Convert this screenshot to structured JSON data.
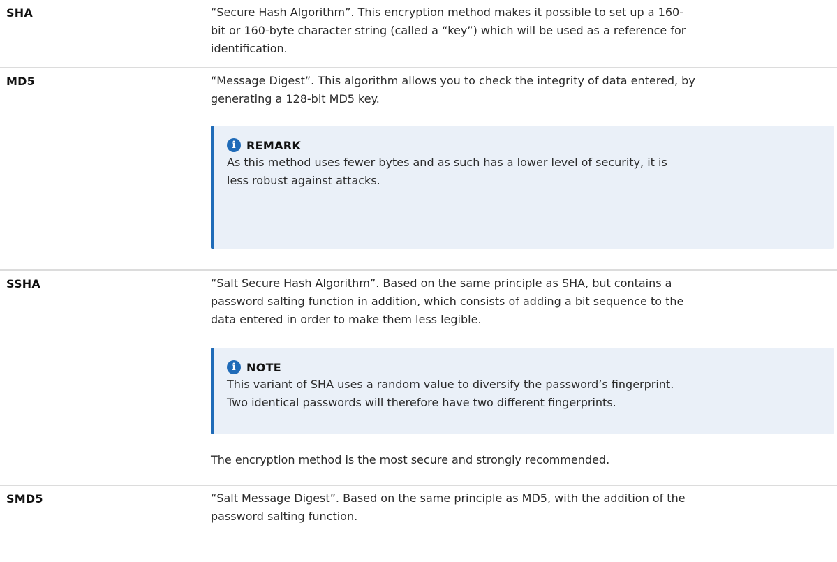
{
  "rows": [
    {
      "term": "SHA",
      "desc": [
        "“Secure Hash Algorithm”. This encryption method makes it possible to set up a 160-",
        "bit or 160-byte character string (called a “key”) which will be used as a reference for",
        "identification."
      ]
    },
    {
      "term": "MD5",
      "desc": [
        "“Message Digest”. This algorithm allows you to check the integrity of data entered, by",
        "generating a 128-bit MD5 key."
      ],
      "callout": {
        "title": "REMARK",
        "body": [
          "As this method uses fewer bytes and as such has a lower level of security, it is",
          "less robust against attacks."
        ]
      }
    },
    {
      "term": "SSHA",
      "desc": [
        "“Salt Secure Hash Algorithm”. Based on the same principle as SHA, but contains a",
        "password salting function in addition, which consists of adding a bit sequence to the",
        "data entered in order to make them less legible."
      ],
      "callout": {
        "title": "NOTE",
        "body": [
          "This variant of SHA uses a random value to diversify the password’s fingerprint.",
          "Two identical passwords will therefore have two different fingerprints."
        ]
      },
      "after": "The encryption method is the most secure and strongly recommended."
    },
    {
      "term": "SMD5",
      "desc": [
        "“Salt Message Digest”. Based on the same principle as MD5, with the addition of the",
        "password salting function."
      ]
    }
  ],
  "icons": {
    "callout": "info-icon"
  },
  "colors": {
    "accent": "#1f6bb8",
    "callout_bg": "#eaf0f8",
    "divider": "#dcdcdc"
  }
}
